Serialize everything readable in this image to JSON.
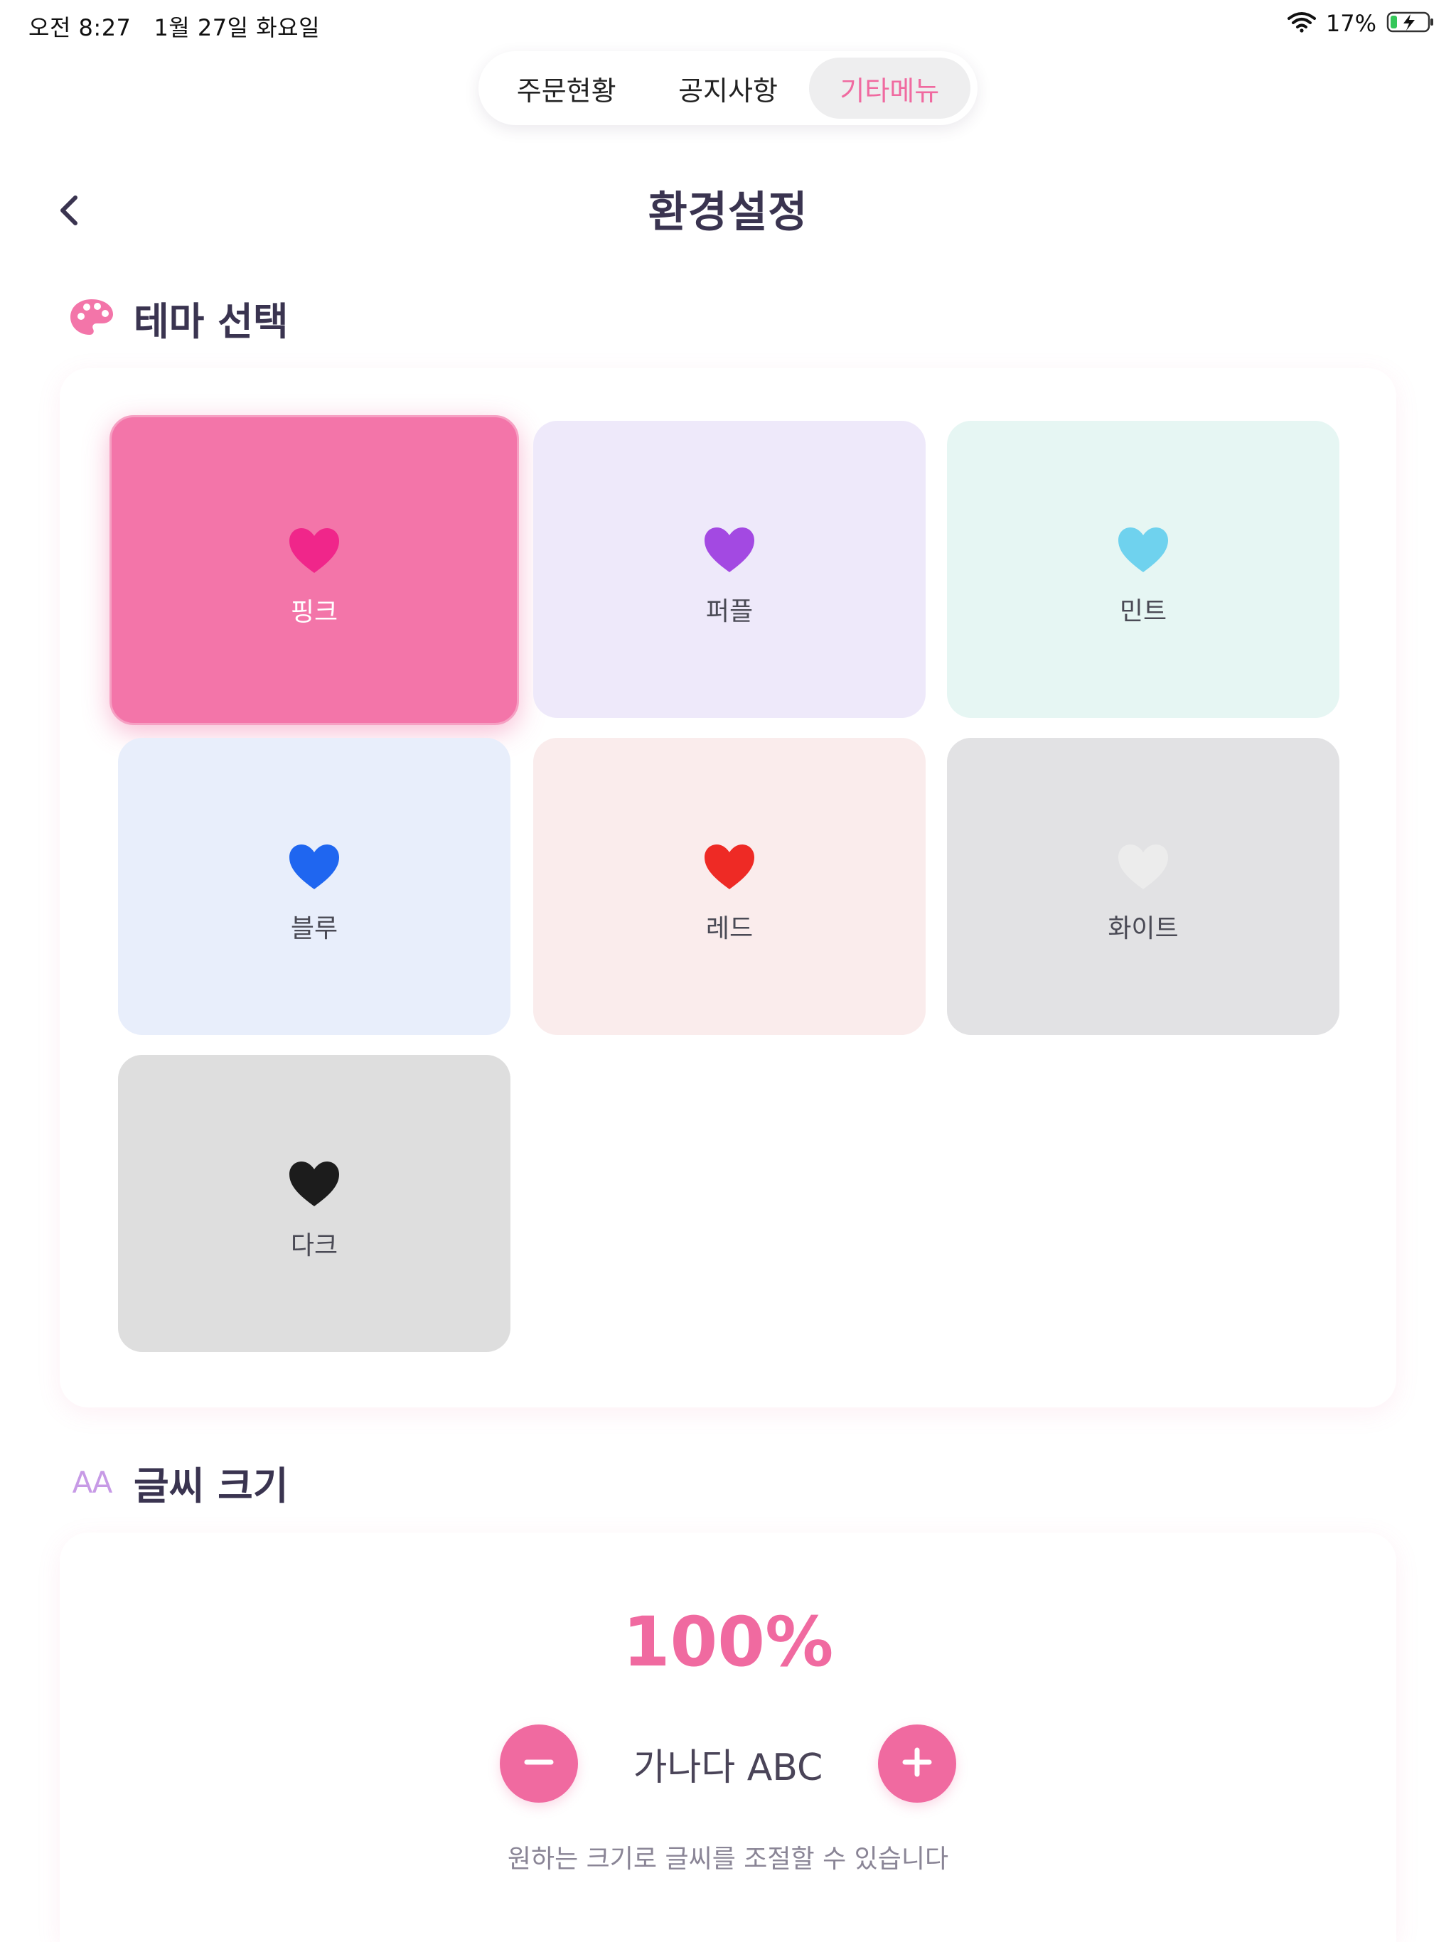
{
  "status_bar": {
    "time": "오전 8:27",
    "date": "1월 27일 화요일",
    "battery": "17%"
  },
  "tabs": [
    {
      "label": "주문현황",
      "active": false
    },
    {
      "label": "공지사항",
      "active": false
    },
    {
      "label": "기타메뉴",
      "active": true
    }
  ],
  "header": {
    "title": "환경설정"
  },
  "theme_section": {
    "title": "테마 선택",
    "themes": [
      {
        "label": "핑크",
        "selected": true,
        "tile_color": "#f375a9",
        "heart_color": "#f0268a"
      },
      {
        "label": "퍼플",
        "selected": false,
        "tile_color": "#eee9fa",
        "heart_color": "#a349e2"
      },
      {
        "label": "민트",
        "selected": false,
        "tile_color": "#e6f6f3",
        "heart_color": "#6fd2ee"
      },
      {
        "label": "블루",
        "selected": false,
        "tile_color": "#e8eefb",
        "heart_color": "#1f66f0"
      },
      {
        "label": "레드",
        "selected": false,
        "tile_color": "#faecec",
        "heart_color": "#ee2a25"
      },
      {
        "label": "화이트",
        "selected": false,
        "tile_color": "#e2e2e4",
        "heart_color": "#ececec"
      },
      {
        "label": "다크",
        "selected": false,
        "tile_color": "#dedede",
        "heart_color": "#1c1c1c"
      }
    ]
  },
  "font_section": {
    "title": "글씨 크기",
    "icon_text": "AA",
    "percent": "100%",
    "preview": "가나다 ABC",
    "hint": "원하는 크기로 글씨를 조절할 수 있습니다"
  },
  "colors": {
    "accent": "#f06aa0",
    "text": "#3a3450"
  }
}
